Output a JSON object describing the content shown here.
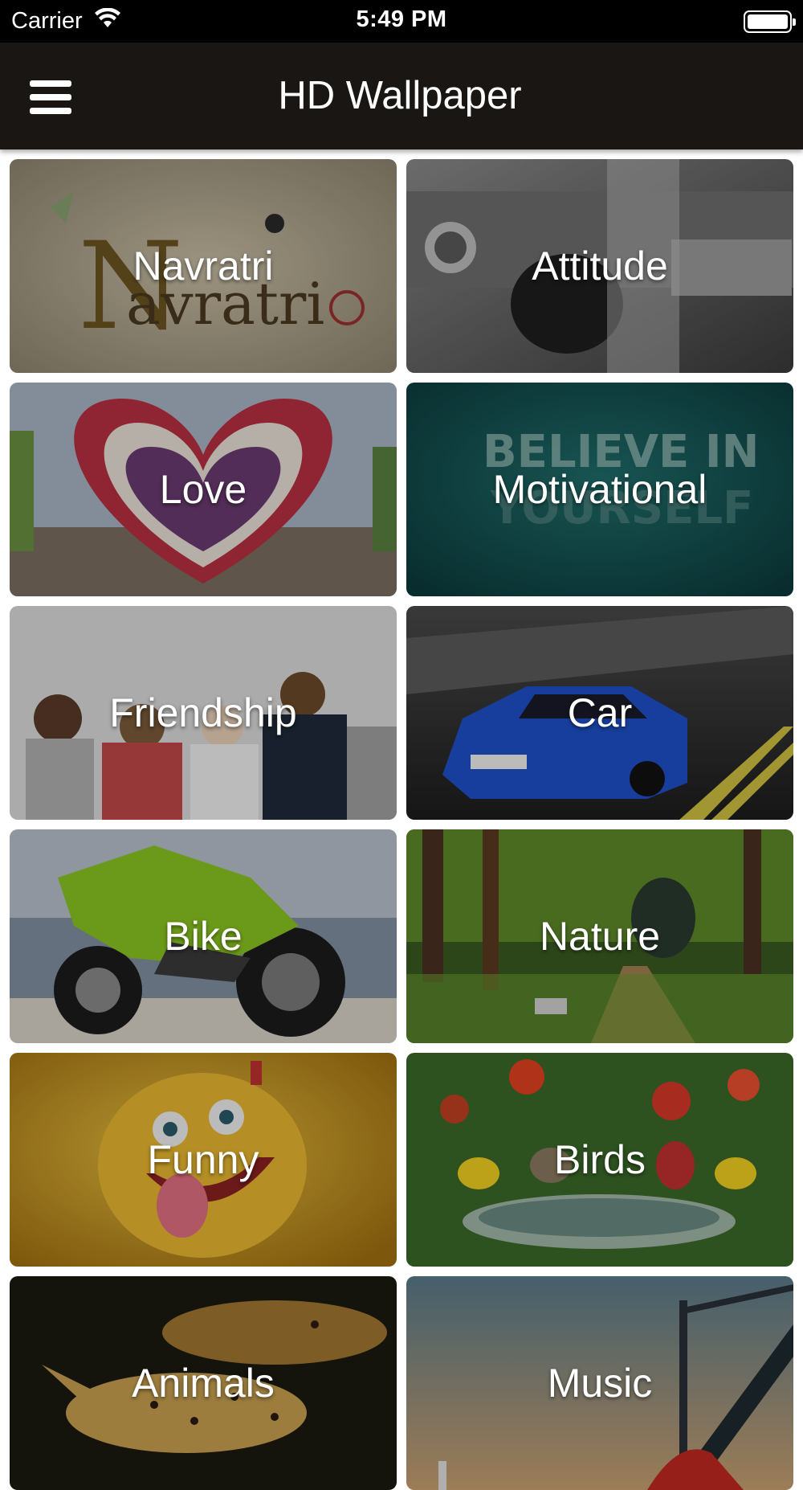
{
  "status_bar": {
    "carrier": "Carrier",
    "time": "5:49 PM",
    "wifi_icon": "wifi-icon",
    "battery_icon": "battery-icon"
  },
  "nav": {
    "menu_icon": "hamburger-menu-icon",
    "title": "HD Wallpaper"
  },
  "colors": {
    "nav_background": "#191614",
    "status_background": "#000000",
    "label_color": "#ffffff"
  },
  "categories": [
    {
      "label": "Navratri"
    },
    {
      "label": "Attitude"
    },
    {
      "label": "Love"
    },
    {
      "label": "Motivational"
    },
    {
      "label": "Friendship"
    },
    {
      "label": "Car"
    },
    {
      "label": "Bike"
    },
    {
      "label": "Nature"
    },
    {
      "label": "Funny"
    },
    {
      "label": "Birds"
    },
    {
      "label": "Animals"
    },
    {
      "label": "Music"
    }
  ]
}
